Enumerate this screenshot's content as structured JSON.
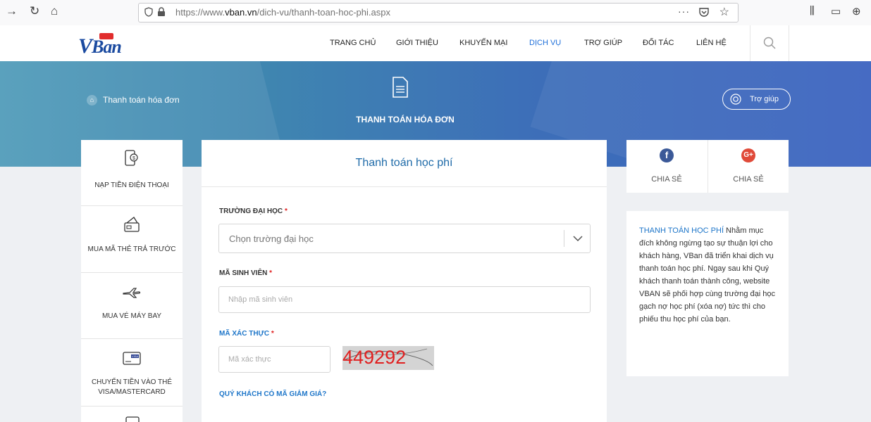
{
  "browser": {
    "url_prefix": "https://www.",
    "url_domain": "vban.vn",
    "url_path": "/dich-vu/thanh-toan-hoc-phi.aspx",
    "more_label": "···"
  },
  "site": {
    "logo_text": "Ban",
    "logo_v": "V",
    "menu": [
      "TRANG CHỦ",
      "GIỚI THIỆU",
      "KHUYẾN MẠI",
      "DỊCH VỤ",
      "TRỢ GIÚP",
      "ĐỐI TÁC",
      "LIÊN HỆ"
    ],
    "active_menu": "DỊCH VỤ"
  },
  "banner": {
    "breadcrumb": "Thanh toán hóa đơn",
    "title": "THANH TOÁN HÓA ĐƠN",
    "help_label": "Trợ giúp"
  },
  "sidebar": {
    "items": [
      {
        "icon": "phone-topup-icon",
        "label": "NẠP TIỀN ĐIỆN THOẠI"
      },
      {
        "icon": "prepaid-card-icon",
        "label": "MUA MÃ THẺ TRẢ TRƯỚC"
      },
      {
        "icon": "airplane-icon",
        "label": "MUA VÉ MÁY BAY"
      },
      {
        "icon": "visa-card-icon",
        "label": "CHUYỂN TIỀN VÀO THẺ VISA/MASTERCARD"
      }
    ]
  },
  "form": {
    "title": "Thanh toán học phí",
    "university_label": "TRƯỜNG ĐẠI HỌC",
    "university_value": "Chọn trường đại học",
    "student_id_label": "MÃ SINH VIÊN",
    "student_id_placeholder": "Nhập mã sinh viên",
    "captcha_label": "MÃ XÁC THỰC",
    "captcha_placeholder": "Mã xác thực",
    "captcha_code": "449292",
    "required_mark": "*",
    "discount_link": "QUÝ KHÁCH CÓ MÃ GIẢM GIÁ?"
  },
  "share": {
    "facebook_label": "CHIA SẺ",
    "google_label": "CHIA SẺ",
    "facebook_glyph": "f",
    "google_glyph": "G+"
  },
  "info": {
    "highlight": "THANH TOÁN HỌC PHÍ",
    "body": " Nhằm mục đích không ngừng tạo sự thuận lợi cho khách hàng, VBan đã triển khai dịch vụ thanh toán học phí. Ngay sau khi Quý khách thanh toán thành công, website VBAN sẽ phối hợp cùng trường đại học gạch nợ học phí (xóa nợ) tức thì cho phiếu thu học phí của bạn."
  },
  "colors": {
    "accent": "#1e76c9",
    "required": "#e02020",
    "facebook": "#3b5998",
    "google": "#e04a39"
  }
}
